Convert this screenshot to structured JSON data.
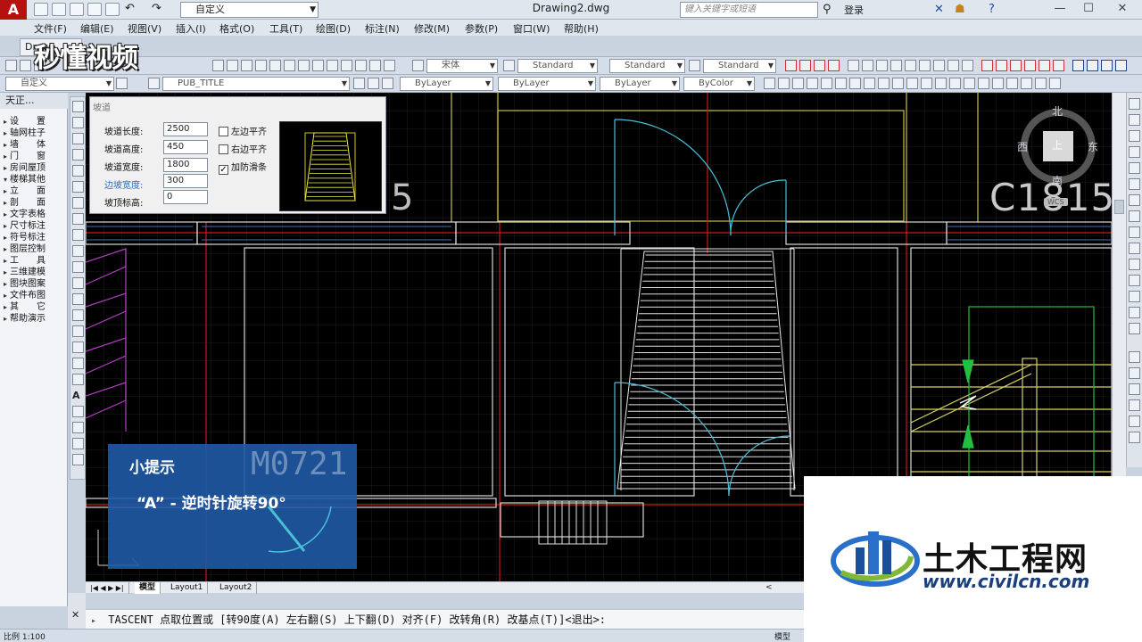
{
  "titlebar": {
    "app_logo": "A",
    "workspace": "自定义",
    "document_title": "Drawing2.dwg",
    "search_placeholder": "键入关键字或短语",
    "login": "登录",
    "minimize": "—",
    "maximize": "☐",
    "close": "✕"
  },
  "menubar": {
    "items": [
      "文件(F)",
      "编辑(E)",
      "视图(V)",
      "插入(I)",
      "格式(O)",
      "工具(T)",
      "绘图(D)",
      "标注(N)",
      "修改(M)",
      "参数(P)",
      "窗口(W)",
      "帮助(H)"
    ]
  },
  "watermark": {
    "text": "秒懂视频"
  },
  "toolbars": {
    "file_tab": "Draw",
    "font_combo": "宋体",
    "text_style": "Standard",
    "dim_style": "Standard",
    "table_style": "Standard",
    "workspace_combo": "自定义",
    "layer_combo": "PUB_TITLE",
    "color_combo": "ByLayer",
    "linetype_combo": "ByLayer",
    "lineweight_combo": "ByLayer",
    "plotstyle_combo": "ByColor"
  },
  "left_panel": {
    "title": "天正...",
    "items": [
      "设　　置",
      "轴网柱子",
      "墙　　体",
      "门　　窗",
      "房间屋顶",
      "楼梯其他",
      "立　　面",
      "剖　　面",
      "文字表格",
      "尺寸标注",
      "符号标注",
      "图层控制",
      "工　　具",
      "三维建模",
      "图块图案",
      "文件布图",
      "其　　它",
      "帮助演示"
    ]
  },
  "dialog": {
    "title": "坡道",
    "fields": [
      {
        "label": "坡道长度:",
        "value": "2500"
      },
      {
        "label": "坡道高度:",
        "value": "450"
      },
      {
        "label": "坡道宽度:",
        "value": "1800"
      },
      {
        "label": "边坡宽度:",
        "value": "300"
      },
      {
        "label": "坡顶标高:",
        "value": "0"
      }
    ],
    "checkboxes": [
      {
        "label": "左边平齐",
        "checked": false
      },
      {
        "label": "右边平齐",
        "checked": false
      },
      {
        "label": "加防滑条",
        "checked": true
      }
    ]
  },
  "drawing": {
    "label_c1815": "C1815",
    "label_5": "5",
    "compass": {
      "north": "北",
      "south": "南",
      "east": "东",
      "west": "西",
      "top": "上",
      "wcs": "WCS"
    }
  },
  "tip": {
    "title": "小提示",
    "text": "“A” - 逆时针旋转90°",
    "code": "M0721"
  },
  "layout_tabs": [
    "模型",
    "Layout1",
    "Layout2"
  ],
  "command": {
    "prompt_icon": "▸",
    "text": "TASCENT 点取位置或 [转90度(A) 左右翻(S) 上下翻(D) 对齐(F) 改转角(R) 改基点(T)]<退出>:"
  },
  "statusbar": {
    "scale": "比例 1:100",
    "model": "模型"
  },
  "brand": {
    "name": "土木工程网",
    "url": "www.civilcn.com"
  }
}
